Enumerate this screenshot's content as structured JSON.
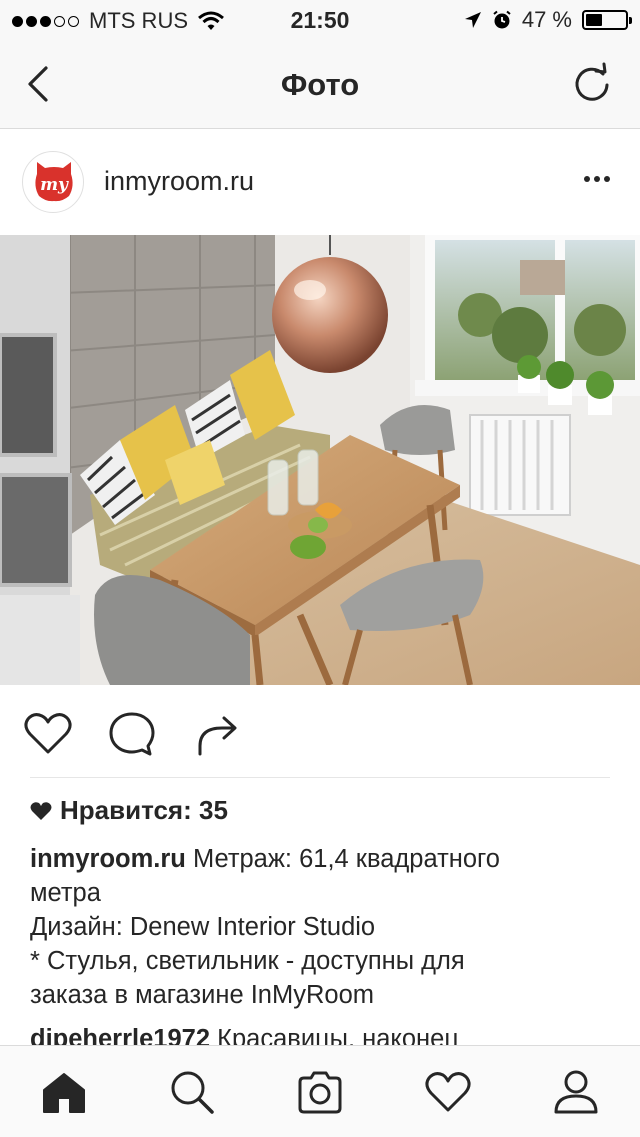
{
  "status_bar": {
    "carrier": "MTS RUS",
    "time": "21:50",
    "battery_percent": "47 %",
    "battery_level": 0.47,
    "signal_bars": 3,
    "signal_total": 5
  },
  "navbar": {
    "title": "Фото"
  },
  "post": {
    "username": "inmyroom.ru",
    "likes_label": "Нравится: 35",
    "caption_line1": "Метраж: 61,4 квадратного",
    "caption_line2": "метра",
    "caption_line3": "Дизайн: Denew Interior Studio",
    "caption_line4": "* Стулья, светильник - доступны для",
    "caption_line5": "заказа в магазине InMyRoom",
    "comment_user": "dipeherrle1972",
    "comment_text": "Красавицы, наконец"
  },
  "icons": {
    "back": "chevron-left-icon",
    "refresh": "refresh-icon",
    "more": "more-options-icon",
    "like": "heart-icon",
    "comment": "comment-icon",
    "share": "share-icon",
    "home": "home-icon",
    "search": "search-icon",
    "camera": "camera-icon",
    "activity": "heart-icon",
    "profile": "profile-icon"
  },
  "colors": {
    "brand_red": "#d9322c",
    "text": "#262626",
    "copper": "#c98a6d"
  }
}
